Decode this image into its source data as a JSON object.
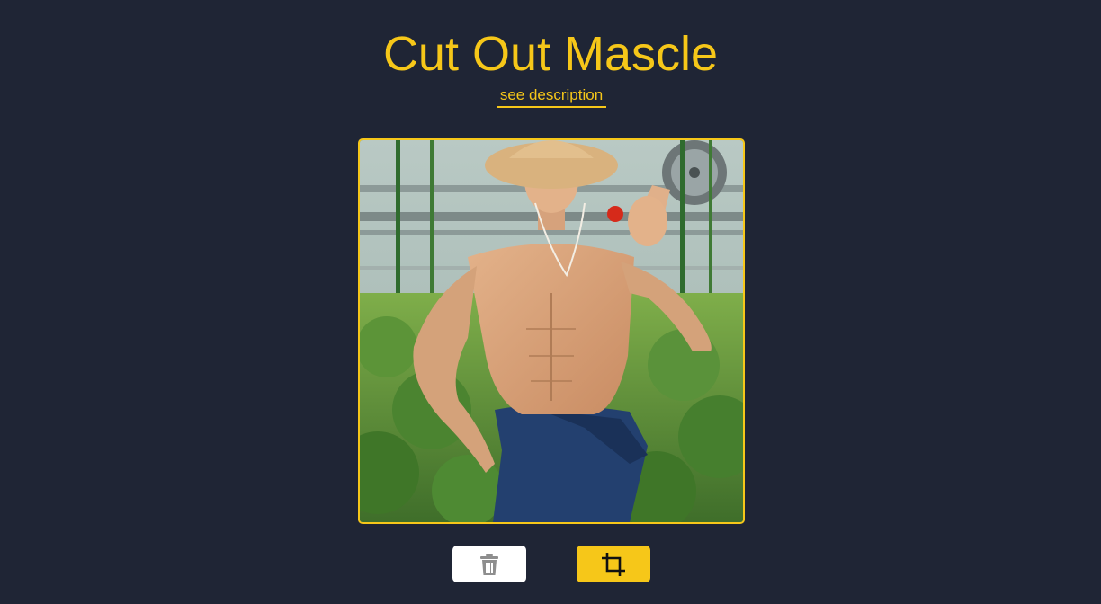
{
  "header": {
    "title": "Cut Out Mascle",
    "description_link": "see description"
  },
  "image": {
    "subject": "shirtless man in straw hat holding a cherry tomato in a greenhouse"
  },
  "toolbar": {
    "delete_icon": "trash-icon",
    "crop_icon": "crop-icon"
  },
  "colors": {
    "background": "#1f2535",
    "accent": "#f6c719",
    "delete_button_bg": "#ffffff"
  }
}
